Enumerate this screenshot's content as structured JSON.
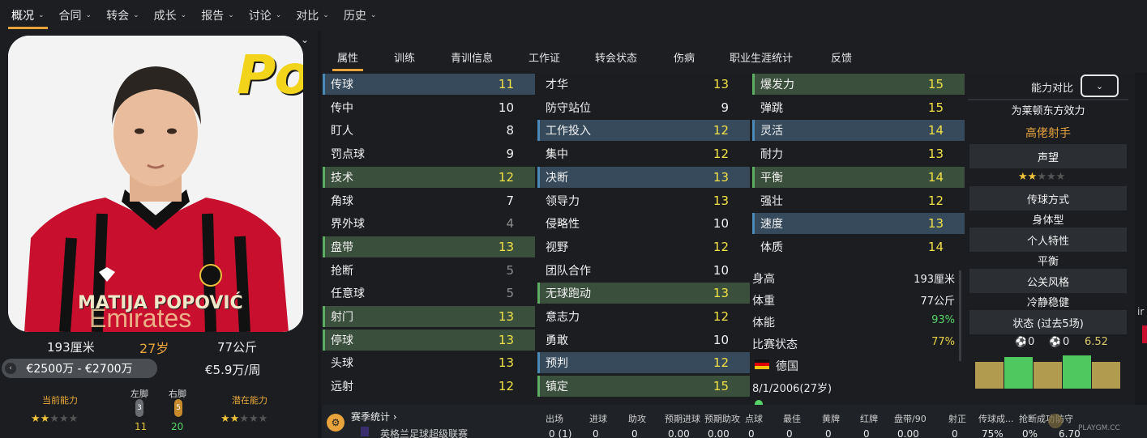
{
  "nav": {
    "items": [
      "概况",
      "合同",
      "转会",
      "成长",
      "报告",
      "讨论",
      "对比",
      "历史"
    ]
  },
  "player": {
    "name_overlay": "MATIJA POPOVIĆ",
    "shirt_text": "Po",
    "height": "193厘米",
    "age": "27岁",
    "weight": "77公斤",
    "value_range": "€2500万 - €2700万",
    "wage": "€5.9万/周",
    "current_ability_label": "当前能力",
    "potential_ability_label": "潜在能力",
    "left_foot_label": "左脚",
    "right_foot_label": "右脚",
    "left_foot_value": "3",
    "right_foot_value": "5",
    "left_foot_score": "11",
    "right_foot_score": "20"
  },
  "tabs": [
    "属性",
    "训练",
    "青训信息",
    "工作证",
    "转会状态",
    "伤病",
    "职业生涯统计",
    "反馈"
  ],
  "attributes": {
    "technical": [
      {
        "label": "传球",
        "value": "11",
        "hl": "blue",
        "color": "y"
      },
      {
        "label": "传中",
        "value": "10",
        "hl": "",
        "color": "w"
      },
      {
        "label": "盯人",
        "value": "8",
        "hl": "",
        "color": "w"
      },
      {
        "label": "罚点球",
        "value": "9",
        "hl": "",
        "color": "w"
      },
      {
        "label": "技术",
        "value": "12",
        "hl": "green",
        "color": "y"
      },
      {
        "label": "角球",
        "value": "7",
        "hl": "",
        "color": "w"
      },
      {
        "label": "界外球",
        "value": "4",
        "hl": "",
        "color": "g"
      },
      {
        "label": "盘带",
        "value": "13",
        "hl": "green",
        "color": "y"
      },
      {
        "label": "抢断",
        "value": "5",
        "hl": "",
        "color": "g"
      },
      {
        "label": "任意球",
        "value": "5",
        "hl": "",
        "color": "g"
      },
      {
        "label": "射门",
        "value": "13",
        "hl": "green",
        "color": "y"
      },
      {
        "label": "停球",
        "value": "13",
        "hl": "green",
        "color": "y"
      },
      {
        "label": "头球",
        "value": "13",
        "hl": "",
        "color": "y"
      },
      {
        "label": "远射",
        "value": "12",
        "hl": "",
        "color": "y"
      }
    ],
    "mental": [
      {
        "label": "才华",
        "value": "13",
        "hl": "",
        "color": "y"
      },
      {
        "label": "防守站位",
        "value": "9",
        "hl": "",
        "color": "w"
      },
      {
        "label": "工作投入",
        "value": "12",
        "hl": "blue",
        "color": "y"
      },
      {
        "label": "集中",
        "value": "12",
        "hl": "",
        "color": "y"
      },
      {
        "label": "决断",
        "value": "13",
        "hl": "blue",
        "color": "y"
      },
      {
        "label": "领导力",
        "value": "13",
        "hl": "",
        "color": "y"
      },
      {
        "label": "侵略性",
        "value": "10",
        "hl": "",
        "color": "w"
      },
      {
        "label": "视野",
        "value": "12",
        "hl": "",
        "color": "y"
      },
      {
        "label": "团队合作",
        "value": "10",
        "hl": "",
        "color": "w"
      },
      {
        "label": "无球跑动",
        "value": "13",
        "hl": "green",
        "color": "y"
      },
      {
        "label": "意志力",
        "value": "12",
        "hl": "",
        "color": "y"
      },
      {
        "label": "勇敢",
        "value": "10",
        "hl": "",
        "color": "w"
      },
      {
        "label": "预判",
        "value": "12",
        "hl": "blue",
        "color": "y"
      },
      {
        "label": "镇定",
        "value": "15",
        "hl": "green",
        "color": "y"
      }
    ],
    "physical": [
      {
        "label": "爆发力",
        "value": "15",
        "hl": "green",
        "color": "y"
      },
      {
        "label": "弹跳",
        "value": "15",
        "hl": "",
        "color": "y"
      },
      {
        "label": "灵活",
        "value": "14",
        "hl": "blue",
        "color": "y"
      },
      {
        "label": "耐力",
        "value": "13",
        "hl": "",
        "color": "y"
      },
      {
        "label": "平衡",
        "value": "14",
        "hl": "green",
        "color": "y"
      },
      {
        "label": "强壮",
        "value": "12",
        "hl": "",
        "color": "y"
      },
      {
        "label": "速度",
        "value": "13",
        "hl": "blue",
        "color": "y"
      },
      {
        "label": "体质",
        "value": "14",
        "hl": "",
        "color": "y"
      }
    ]
  },
  "info": [
    {
      "label": "身高",
      "value": "193厘米",
      "color": "#f0f0f0"
    },
    {
      "label": "体重",
      "value": "77公斤",
      "color": "#f0f0f0"
    },
    {
      "label": "体能",
      "value": "93%",
      "color": "#57d36a"
    },
    {
      "label": "比赛状态",
      "value": "77%",
      "color": "#e8d24a"
    }
  ],
  "nationality": "德国",
  "birth": "8/1/2006(27岁)",
  "right": {
    "compare_label": "能力对比",
    "club_text": "为莱顿东方效力",
    "role": "高佬射手",
    "reputation_label": "声望",
    "passing_label": "传球方式",
    "passing_value": "身体型",
    "personality_label": "个人特性",
    "personality_value": "平衡",
    "media_label": "公关风格",
    "media_value": "冷静稳健",
    "form_label": "状态 (过去5场)",
    "goals": "0",
    "assists": "0",
    "rating": "6.52",
    "form_bars": [
      0.55,
      0.65,
      0.55,
      0.68,
      0.55
    ]
  },
  "season": {
    "title": "赛季统计 ›",
    "competition": "英格兰足球超级联赛",
    "headers": [
      "出场",
      "进球",
      "助攻",
      "预期进球",
      "预期助攻",
      "点球",
      "最佳",
      "黄牌",
      "红牌",
      "盘带/90",
      "射正",
      "传球成...",
      "抢断成功",
      "防守"
    ],
    "values": [
      "0 (1)",
      "0",
      "0",
      "0.00",
      "0.00",
      "0",
      "0",
      "0",
      "0",
      "0.00",
      "0",
      "75%",
      "0%",
      "6.70"
    ]
  },
  "watermark": "PLAYGM.CC",
  "colors": {
    "accent": "#e8a33c",
    "yellow": "#f0e246",
    "green": "#57d36a",
    "blue_hl": "#364a5c",
    "green_hl": "#3b4f3d"
  }
}
